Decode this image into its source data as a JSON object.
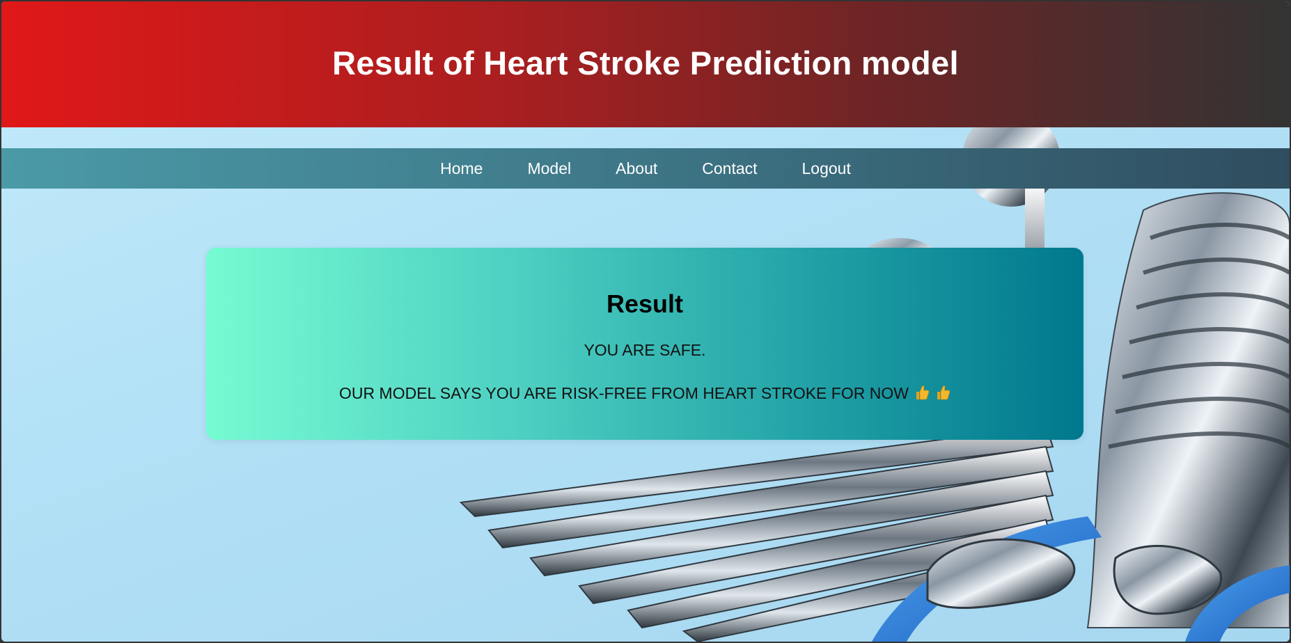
{
  "header": {
    "title": "Result of Heart Stroke Prediction model"
  },
  "nav": {
    "items": [
      {
        "label": "Home"
      },
      {
        "label": "Model"
      },
      {
        "label": "About"
      },
      {
        "label": "Contact"
      },
      {
        "label": "Logout"
      }
    ]
  },
  "result": {
    "heading": "Result",
    "status": "YOU ARE SAFE.",
    "message": "OUR MODEL SAYS YOU ARE RISK-FREE FROM HEART STROKE FOR NOW",
    "icons": [
      "thumbs-up-icon",
      "thumbs-up-icon"
    ]
  },
  "colors": {
    "header_start": "#e01818",
    "header_end": "#333333",
    "nav_start": "#4b9aa8",
    "nav_end": "#2f4d5f",
    "card_start": "#76fbd2",
    "card_end": "#00788e"
  }
}
